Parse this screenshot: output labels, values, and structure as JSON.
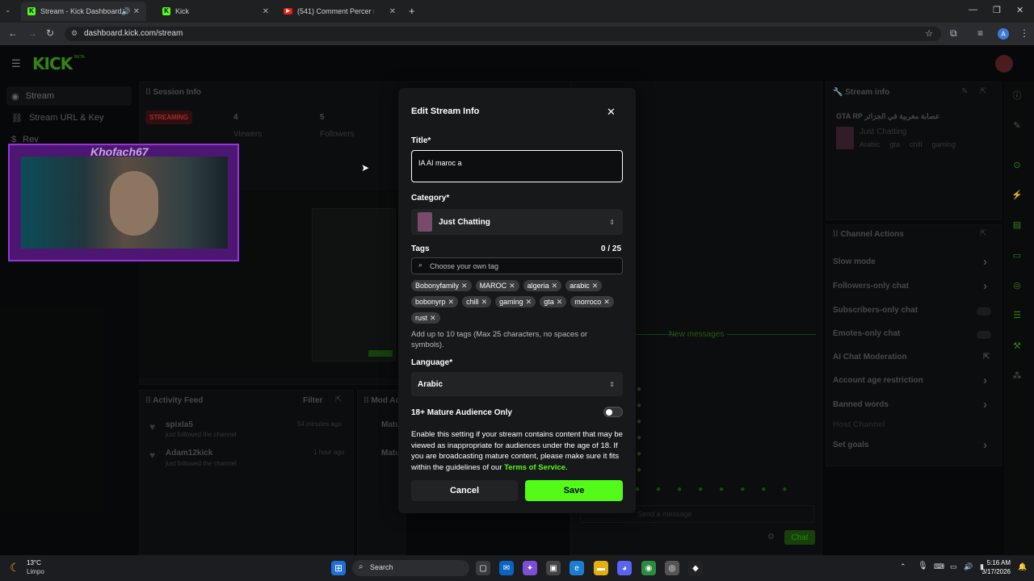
{
  "browser": {
    "tabs": [
      {
        "title": "Stream - Kick Dashboard"
      },
      {
        "title": "Kick"
      },
      {
        "title": "(541) Comment Percer sur"
      }
    ],
    "url": "dashboard.kick.com/stream",
    "profile_initial": "A"
  },
  "sidebar": {
    "logo": "KICK",
    "logo_tag": "BETA",
    "items": [
      {
        "label": "Stream"
      },
      {
        "label": "Stream URL & Key"
      },
      {
        "label": "Rev"
      }
    ]
  },
  "session": {
    "title": "Session Info",
    "status": "STREAMING",
    "viewers_count": "4",
    "viewers_label": "Viewers",
    "followers_count": "5",
    "followers_label": "Followers"
  },
  "webcam": {
    "overlay_name": "Khofach67"
  },
  "activity": {
    "title": "Activity Feed",
    "filter_label": "Filter",
    "items": [
      {
        "user": "spixla5",
        "action": "just followed the channel",
        "time": "54 minutes ago"
      },
      {
        "user": "Adam12kick",
        "action": "just followed the channel",
        "time": "1 hour ago"
      }
    ]
  },
  "modactions": {
    "title": "Mod Ac",
    "items": [
      {
        "label": "Matu"
      },
      {
        "label": "Matu"
      }
    ]
  },
  "chat": {
    "new_messages": "New messages",
    "placeholder": "Send a message",
    "send_label": "Chat"
  },
  "stream_info": {
    "title": "Stream info",
    "stream_title": "GTA RP عصابة مغربية في الجزائر",
    "category": "Just Chatting",
    "tags": [
      "Arabic",
      "gta",
      "chill",
      "gaming"
    ]
  },
  "channel_actions": {
    "title": "Channel Actions",
    "items": [
      {
        "label": "Slow mode",
        "control": "arrow"
      },
      {
        "label": "Followers-only chat",
        "control": "arrow"
      },
      {
        "label": "Subscribers-only chat",
        "control": "toggle"
      },
      {
        "label": "Emotes-only chat",
        "control": "toggle"
      },
      {
        "label": "AI Chat Moderation",
        "control": "link"
      },
      {
        "label": "Account age restriction",
        "control": "arrow"
      },
      {
        "label": "Banned words",
        "control": "arrow"
      },
      {
        "label": "Host Channel",
        "control": "none"
      },
      {
        "label": "Set goals",
        "control": "arrow"
      }
    ]
  },
  "modal": {
    "heading": "Edit Stream Info",
    "title_label": "Title*",
    "title_value": "IA  AI maroc a",
    "category_label": "Category*",
    "category_value": "Just Chatting",
    "tags_label": "Tags",
    "tags_count": "0 / 25",
    "tags_placeholder": "Choose your own tag",
    "tags": [
      "Bobonyfamily",
      "MAROC",
      "algeria",
      "arabic",
      "bobonyrp",
      "chill",
      "gaming",
      "gta",
      "morroco",
      "rust"
    ],
    "tags_help": "Add up to 10 tags (Max 25 characters, no spaces or symbols).",
    "language_label": "Language*",
    "language_value": "Arabic",
    "mature_label": "18+ Mature Audience Only",
    "mature_desc": "Enable this setting if your stream contains content that may be viewed as inappropriate for audiences under the age of 18. If you are broadcasting mature content, please make sure it fits within the guidelines of our",
    "mature_link": "Terms of Service",
    "mature_period": ".",
    "cancel_label": "Cancel",
    "save_label": "Save"
  },
  "taskbar": {
    "weather_temp": "13°C",
    "weather_desc": "Limpo",
    "search_label": "Search",
    "time": "5:16 AM",
    "date": "3/17/2026"
  },
  "colors": {
    "accent": "#53fc18",
    "modal_bg": "#17181a",
    "streaming_badge": "#3a1214"
  }
}
